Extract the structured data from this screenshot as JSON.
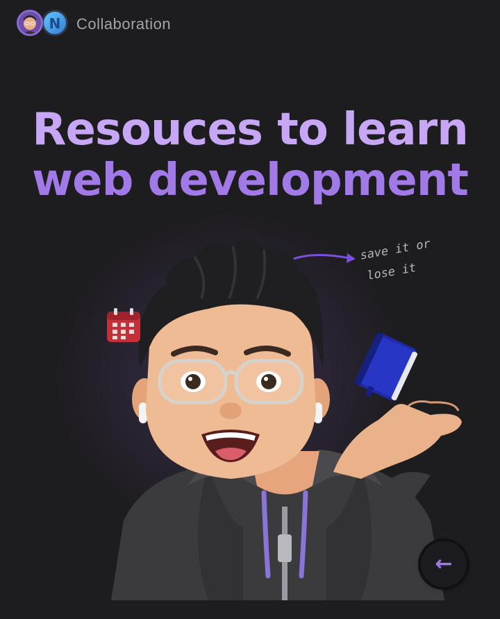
{
  "header": {
    "title": "Collaboration",
    "avatar_secondary_letter": "N"
  },
  "headline": {
    "line1": "Resouces to learn",
    "line2": "web development"
  },
  "annotation": {
    "line1": "save it or",
    "line2": "lose it"
  },
  "icons": {
    "calendar": "calendar-icon",
    "book": "book-icon",
    "back": "arrow-left-icon"
  },
  "colors": {
    "headline_top": "#c6a6f5",
    "headline_bottom": "#a27ae8",
    "accent": "#9d7be0",
    "background": "#1d1c1f"
  }
}
